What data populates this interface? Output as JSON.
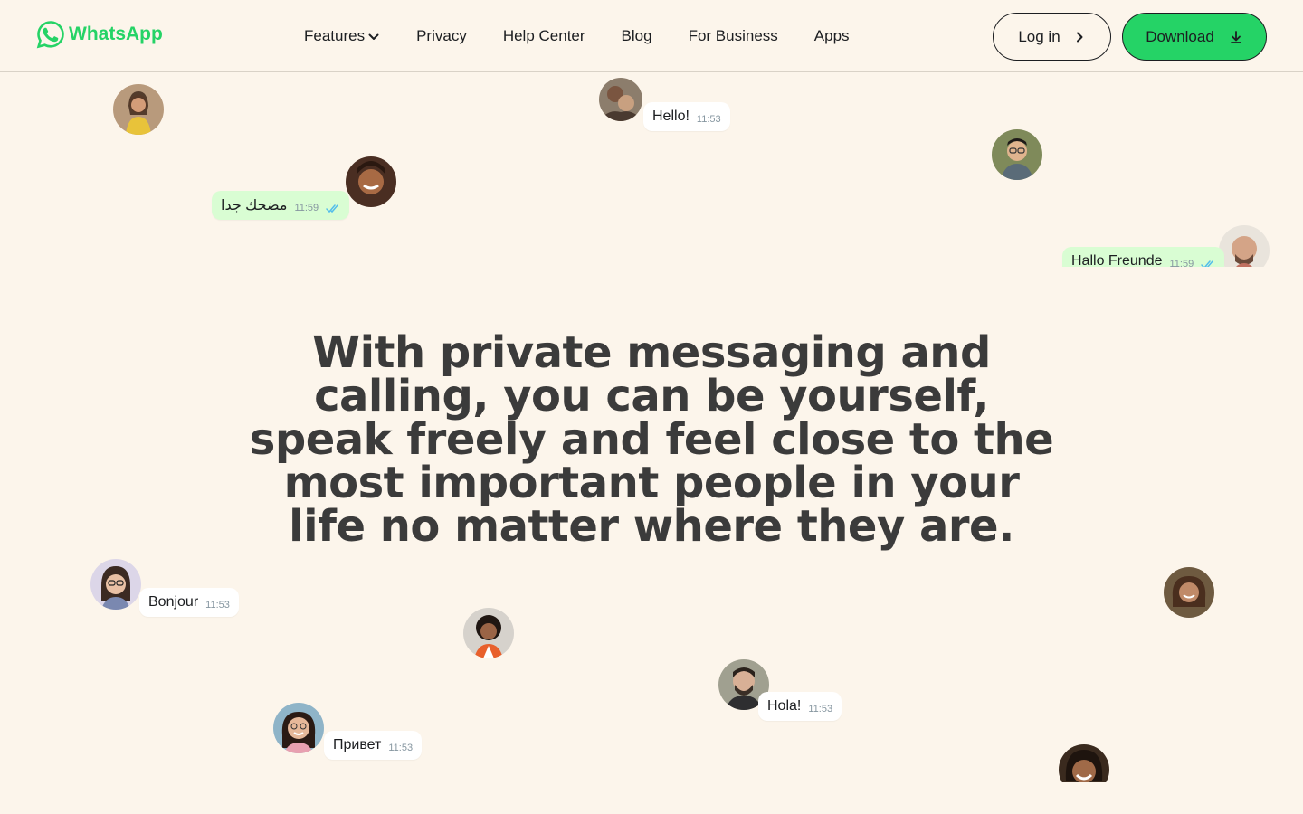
{
  "brand": {
    "name": "WhatsApp",
    "color": "#25d366"
  },
  "nav": {
    "items": [
      {
        "label": "Features",
        "has_dropdown": true
      },
      {
        "label": "Privacy"
      },
      {
        "label": "Help Center"
      },
      {
        "label": "Blog"
      },
      {
        "label": "For Business"
      },
      {
        "label": "Apps"
      }
    ]
  },
  "actions": {
    "login_label": "Log in",
    "download_label": "Download"
  },
  "bubbles": [
    {
      "text": "Hello!",
      "time": "11:53"
    },
    {
      "text": "مضحك جدا",
      "time": "11:59"
    },
    {
      "text": "Hallo Freunde",
      "time": "11:59"
    },
    {
      "text": "Bonjour",
      "time": "11:53"
    },
    {
      "text": "Привет",
      "time": "11:53"
    },
    {
      "text": "Hola!",
      "time": "11:53"
    }
  ],
  "headline": "With private messaging and calling, you can be yourself, speak freely and feel close to the most important people in your life no matter where they are.",
  "colors": {
    "background": "#fcf5eb",
    "bubble_sent": "#d9fdd3",
    "bubble_received": "#ffffff",
    "read_ticks": "#53bdeb"
  }
}
